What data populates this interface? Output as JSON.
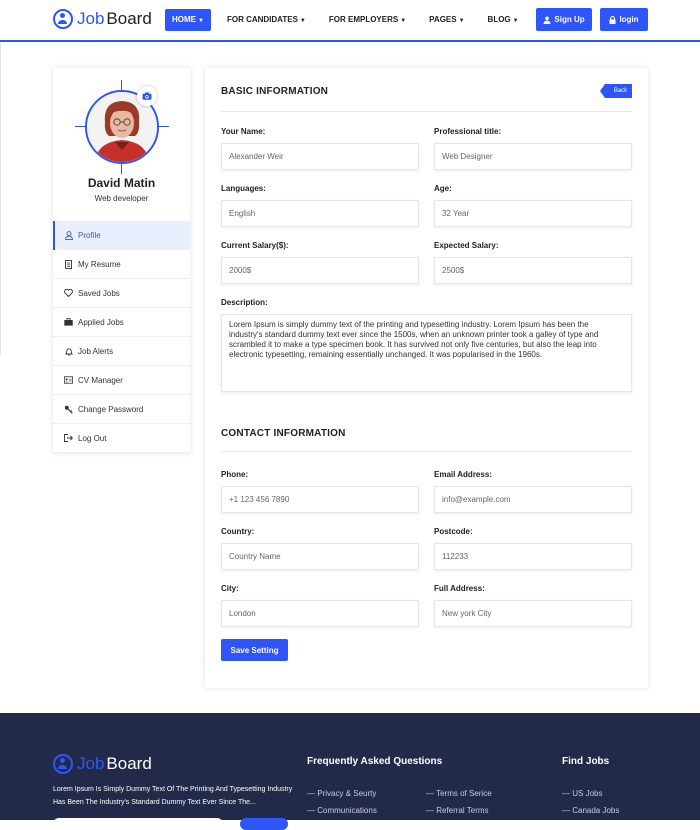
{
  "brand": {
    "part1": "Job",
    "part2": "Board"
  },
  "nav": [
    {
      "label": "HOME",
      "active": true
    },
    {
      "label": "FOR CANDIDATES",
      "active": false
    },
    {
      "label": "FOR EMPLOYERS",
      "active": false
    },
    {
      "label": "PAGES",
      "active": false
    },
    {
      "label": "BLOG",
      "active": false
    }
  ],
  "header_buttons": {
    "signup": "Sign Up",
    "login": "login"
  },
  "profile": {
    "name": "David Matin",
    "role": "Web developer"
  },
  "sidebar": [
    {
      "label": "Profile",
      "icon": "user-icon"
    },
    {
      "label": "My Resume",
      "icon": "document-icon"
    },
    {
      "label": "Saved Jobs",
      "icon": "heart-icon"
    },
    {
      "label": "Applied Jobs",
      "icon": "briefcase-icon"
    },
    {
      "label": "Job Alerts",
      "icon": "bell-icon"
    },
    {
      "label": "CV Manager",
      "icon": "id-card-icon"
    },
    {
      "label": "Change Password",
      "icon": "key-icon"
    },
    {
      "label": "Log Out",
      "icon": "logout-icon"
    }
  ],
  "basic": {
    "title": "BASIC INFORMATION",
    "back": "Back",
    "name_label": "Your Name:",
    "name_value": "Alexander Weir",
    "prof_label": "Professional title:",
    "prof_value": "Web Designer",
    "lang_label": "Languages:",
    "lang_value": "English",
    "age_label": "Age:",
    "age_value": "32 Year",
    "cur_label": "Current Salary($):",
    "cur_value": "2000$",
    "exp_label": "Expected Salary:",
    "exp_value": "2500$",
    "desc_label": "Description:",
    "desc_value": "Lorem Ipsum is simply dummy text of the printing and typesetting industry. Lorem Ipsum has been the industry's standard dummy text ever since the 1500s, when an unknown printer took a galley of type and scrambled it to make a type specimen book. It has survived not only five centuries, but also the leap into electronic typesetting, remaining essentially unchanged. It was popularised in the 1960s."
  },
  "contact": {
    "title": "CONTACT INFORMATION",
    "phone_label": "Phone:",
    "phone_value": "+1 123 456 7890",
    "email_label": "Email Address:",
    "email_value": "info@example.com",
    "country_label": "Country:",
    "country_value": "Country Name",
    "post_label": "Postcode:",
    "post_value": "112233",
    "city_label": "City:",
    "city_value": "London",
    "addr_label": "Full Address:",
    "addr_value": "New york City",
    "save": "Save Setting"
  },
  "footer": {
    "desc": "Lorem Ipsum Is Simply Dummy Text Of The Printing And Typesetting Industry Has Been The Industry's Standard Dummy Text Ever Since The...",
    "faq_title": "Frequently Asked Questions",
    "faq_links": [
      "Privacy & Seurty",
      "Communications",
      "Terms of Serice",
      "Referral Terms"
    ],
    "jobs_title": "Find Jobs",
    "jobs_links": [
      "US Jobs",
      "Canada Jobs"
    ]
  }
}
